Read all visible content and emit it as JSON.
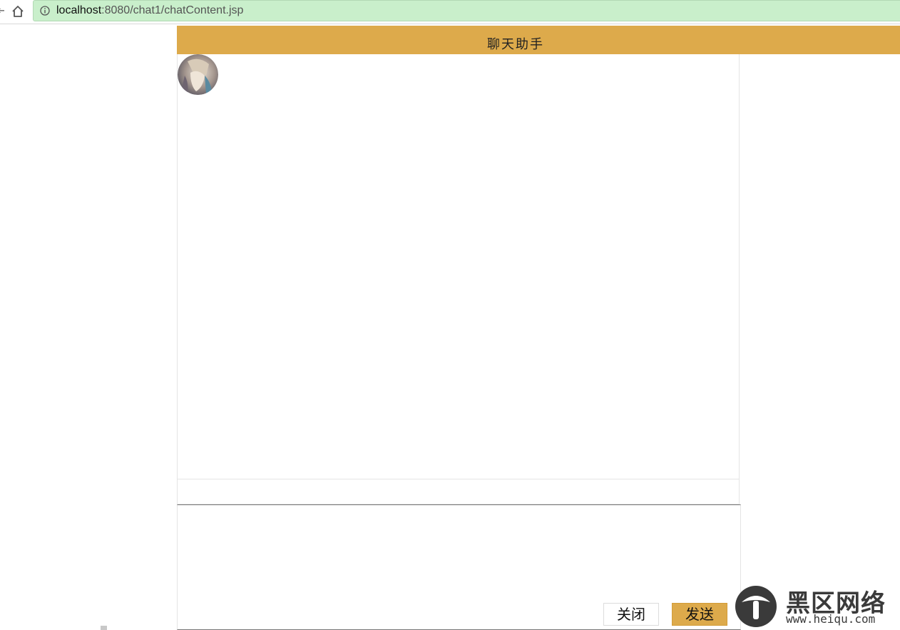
{
  "browser": {
    "url_host": "localhost",
    "url_rest": ":8080/chat1/chatContent.jsp"
  },
  "chat": {
    "title": "聊天助手",
    "input_value": ""
  },
  "buttons": {
    "close_label": "关闭",
    "send_label": "发送"
  },
  "watermark": {
    "cn": "黑区网络",
    "en": "www.heiqu.com"
  },
  "colors": {
    "accent": "#ddaa4b",
    "address_bar": "#c9efcb"
  }
}
